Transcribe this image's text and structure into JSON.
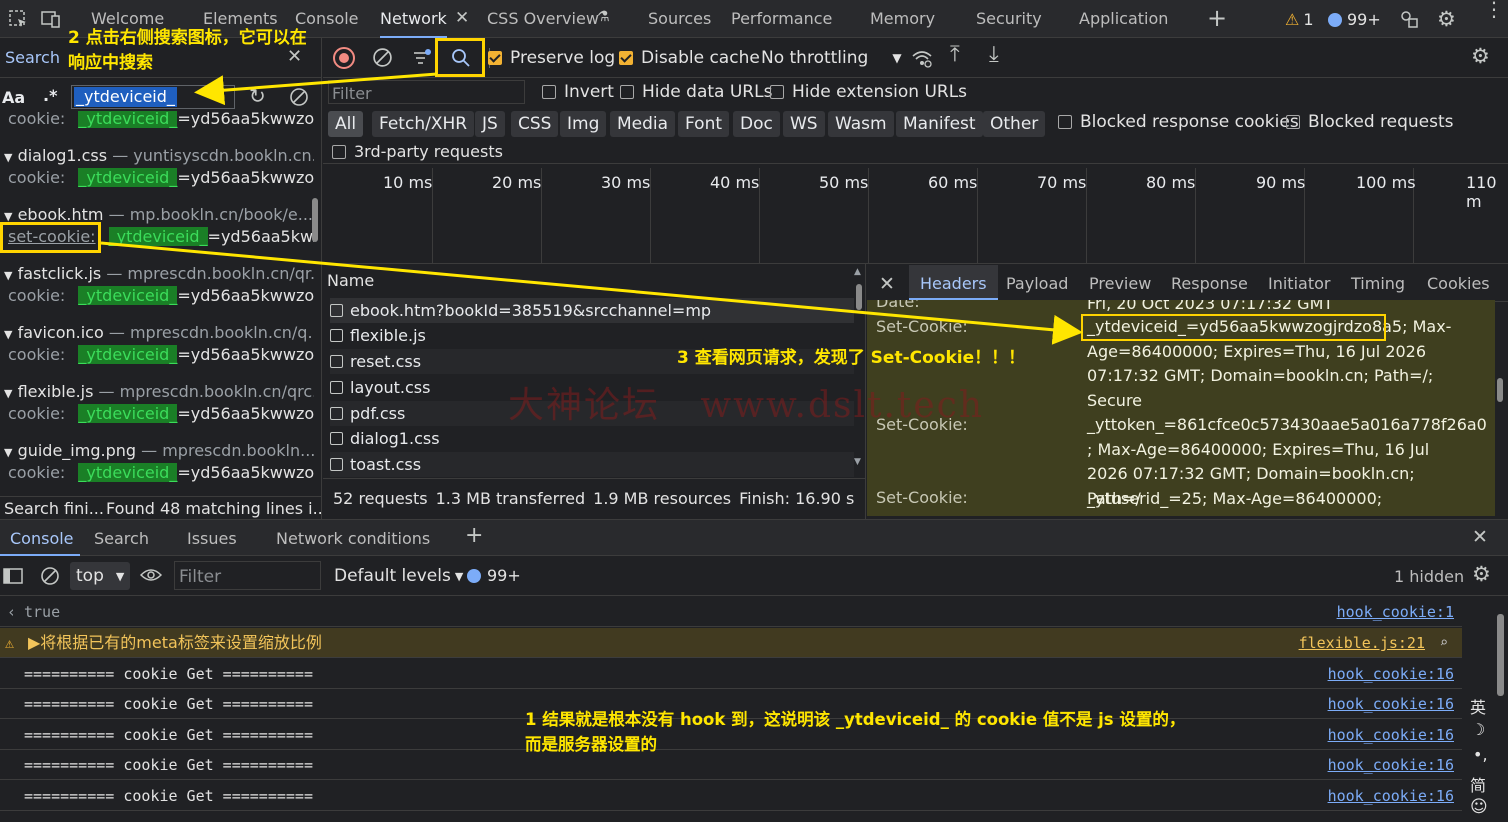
{
  "tabs": [
    "Welcome",
    "Elements",
    "Console",
    "Network",
    "CSS Overview",
    "Sources",
    "Performance",
    "Memory",
    "Security",
    "Application"
  ],
  "status": {
    "warnings": "1",
    "messages": "99+"
  },
  "search_panel": {
    "title": "Search",
    "case_label": "Aa",
    "regex_label": ".*",
    "query": "_ytdeviceid_",
    "results": [
      {
        "cut_line": "cookie:",
        "cut_rest": "=yd56aa5kwwzo..."
      },
      {
        "file": "dialog1.css",
        "sep": "—",
        "url": "yuntisyscdn.bookln.cn...",
        "key": "cookie:",
        "rest": "=yd56aa5kwwzo..."
      },
      {
        "file": "ebook.htm",
        "sep": "—",
        "url": "mp.bookln.cn/book/e...",
        "key": "set-cookie:",
        "rest": "=yd56aa5kw..."
      },
      {
        "file": "fastclick.js",
        "sep": "—",
        "url": "mprescdn.bookln.cn/qr...",
        "key": "cookie:",
        "rest": "=yd56aa5kwwzo..."
      },
      {
        "file": "favicon.ico",
        "sep": "—",
        "url": "mprescdn.bookln.cn/q...",
        "key": "cookie:",
        "rest": "=yd56aa5kwwzo..."
      },
      {
        "file": "flexible.js",
        "sep": "—",
        "url": "mprescdn.bookln.cn/qrc...",
        "key": "cookie:",
        "rest": "=yd56aa5kwwzo..."
      },
      {
        "file": "guide_img.png",
        "sep": "—",
        "url": "mprescdn.bookln....",
        "key": "cookie:",
        "rest": "=yd56aa5kwwzo..."
      }
    ],
    "footer_left": "Search fini...",
    "footer_right": "Found 48 matching lines i..."
  },
  "network": {
    "preserve_log": "Preserve log",
    "disable_cache": "Disable cache",
    "throttling": "No throttling",
    "filter_placeholder": "Filter",
    "invert": "Invert",
    "hide_data": "Hide data URLs",
    "hide_ext": "Hide extension URLs",
    "types": [
      "All",
      "Fetch/XHR",
      "JS",
      "CSS",
      "Img",
      "Media",
      "Font",
      "Doc",
      "WS",
      "Wasm",
      "Manifest",
      "Other"
    ],
    "blocked_cookies": "Blocked response cookies",
    "blocked_requests": "Blocked requests",
    "third_party": "3rd-party requests",
    "ticks": [
      "10 ms",
      "20 ms",
      "30 ms",
      "40 ms",
      "50 ms",
      "60 ms",
      "70 ms",
      "80 ms",
      "90 ms",
      "100 ms",
      "110 m"
    ],
    "name_header": "Name",
    "requests": [
      "ebook.htm?bookId=385519&srcchannel=mp",
      "flexible.js",
      "reset.css",
      "layout.css",
      "pdf.css",
      "dialog1.css",
      "toast.css"
    ],
    "summary": {
      "requests": "52 requests",
      "transferred": "1.3 MB transferred",
      "resources": "1.9 MB resources",
      "finish": "Finish: 16.90 s"
    }
  },
  "details": {
    "tabs": [
      "Headers",
      "Payload",
      "Preview",
      "Response",
      "Initiator",
      "Timing",
      "Cookies"
    ],
    "date_key": "Date:",
    "date_val": "Fri, 20 Oct 2023 07:17:32 GMT",
    "set_cookie_key": "Set-Cookie:",
    "cookie1_highlight": "_ytdeviceid_=yd56aa5kwwzogjrdzo8a5;",
    "cookie1_rest": "Max-Age=86400000; Expires=Thu, 16 Jul 2026 07:17:32 GMT; Domain=bookln.cn; Path=/; Secure",
    "cookie2": "_yttoken_=861cfce0c573430aae5a016a778f26a0 ; Max-Age=86400000; Expires=Thu, 16 Jul 2026 07:17:32 GMT; Domain=bookln.cn; Path=/",
    "cookie3": "_ytuserid_=25; Max-Age=86400000;"
  },
  "drawer": {
    "tabs": [
      "Console",
      "Search",
      "Issues",
      "Network conditions"
    ],
    "context": "top",
    "filter_placeholder": "Filter",
    "levels": "Default levels",
    "count": "99+",
    "hidden": "1 hidden",
    "lines": [
      {
        "text": "true",
        "src": "hook_cookie:1",
        "type": "result"
      },
      {
        "text": "▶将根据已有的meta标签来设置缩放比例",
        "src": "flexible.js:21",
        "type": "warn"
      },
      {
        "text": "========== cookie Get ==========",
        "src": "hook_cookie:16",
        "type": "log"
      },
      {
        "text": "========== cookie Get ==========",
        "src": "hook_cookie:16",
        "type": "log"
      },
      {
        "text": "========== cookie Get ==========",
        "src": "hook_cookie:16",
        "type": "log"
      },
      {
        "text": "========== cookie Get ==========",
        "src": "hook_cookie:16",
        "type": "log"
      },
      {
        "text": "========== cookie Get ==========",
        "src": "hook_cookie:16",
        "type": "log"
      }
    ],
    "ime": [
      "英",
      "简"
    ]
  },
  "annotations": {
    "a2_line1": "2 点击右侧搜索图标，它可以在",
    "a2_line2": "响应中搜索",
    "a3": "3 查看网页请求，发现了 Set-Cookie！！！",
    "a1_line1": "1 结果就是根本没有 hook 到，这说明该 _ytdeviceid_ 的 cookie 值不是 js 设置的，",
    "a1_line2": "而是服务器设置的"
  },
  "watermark": "大神论坛   www.dslt.tech",
  "colors": {
    "annotation": "#ffe600",
    "highlight_bg": "#1a7f26",
    "header_bg": "#3f3f1f",
    "link": "#7cacf8",
    "accent": "#7cacf8"
  }
}
